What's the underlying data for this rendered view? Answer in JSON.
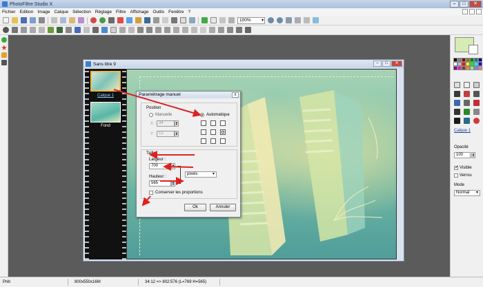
{
  "app": {
    "title": "PhotoFiltre Studio X"
  },
  "window_controls": {
    "minimize": "–",
    "maximize": "□",
    "close": "✕"
  },
  "menu": [
    "Fichier",
    "Edition",
    "Image",
    "Calque",
    "Sélection",
    "Réglage",
    "Filtre",
    "Affichage",
    "Outils",
    "Fenêtre",
    "?"
  ],
  "toolbar": {
    "zoom_value": "100%"
  },
  "document": {
    "title": "Sans titre 9"
  },
  "layers": [
    {
      "label": "Calque 1",
      "selected": true
    },
    {
      "label": "Fond",
      "selected": false
    }
  ],
  "dialog": {
    "title": "Paramétrage manuel",
    "close": "x",
    "position_group": "Position",
    "manual_label": "Manuelle",
    "auto_label": "Automatique",
    "selected_mode": "Automatique",
    "x_label": "X :",
    "x_value": "34",
    "y_label": "Y :",
    "y_value": "12",
    "size_group": "Taille",
    "width_label": "Largeur :",
    "width_value": "700",
    "height_label": "Hauteur :",
    "height_value": "565",
    "unit_value": "pixels",
    "keep_proportions_label": "Conserver les proportions",
    "keep_proportions_checked": false,
    "ok_label": "Ok",
    "cancel_label": "Annuler"
  },
  "right_panel": {
    "layer_name": "Calque 1",
    "opacity_label": "Opacité",
    "opacity_value": "100",
    "visible_label": "Visible",
    "visible_checked": true,
    "lock_label": "Verrou",
    "lock_checked": false,
    "mode_label": "Mode",
    "mode_value": "Normal",
    "foreground_color": "#d6ecb4",
    "background_color": "#ffffff"
  },
  "statusbar": {
    "state": "Prêt",
    "image_size": "800x550x16M",
    "coords": "34:12 => 802:576 (L=769 H=565)"
  },
  "colors": {
    "accent_arrow": "#e02020",
    "workspace": "#5b5b5b"
  }
}
